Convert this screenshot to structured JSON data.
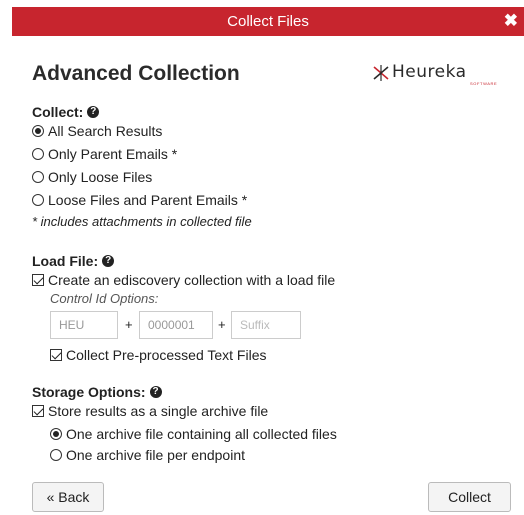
{
  "dialog": {
    "title": "Collect Files",
    "close_label": "✖"
  },
  "heading": "Advanced Collection",
  "logo": {
    "brand": "Heureka",
    "tagline": "SOFTWARE"
  },
  "collect": {
    "label": "Collect:",
    "help": "?",
    "options": [
      {
        "label": "All Search Results",
        "checked": true
      },
      {
        "label": "Only Parent Emails *",
        "checked": false
      },
      {
        "label": "Only Loose Files",
        "checked": false
      },
      {
        "label": "Loose Files and Parent Emails *",
        "checked": false
      }
    ],
    "note": "* includes attachments in collected file"
  },
  "load_file": {
    "label": "Load File:",
    "help": "?",
    "create_label": "Create an ediscovery collection with a load file",
    "create_checked": true,
    "control_id_label": "Control Id Options:",
    "prefix_value": "HEU",
    "number_value": "0000001",
    "suffix_placeholder": "Suffix",
    "plus": "+",
    "preprocessed_label": "Collect Pre-processed Text Files",
    "preprocessed_checked": true
  },
  "storage": {
    "label": "Storage Options:",
    "help": "?",
    "single_archive_label": "Store results as a single archive file",
    "single_archive_checked": true,
    "options": [
      {
        "label": "One archive file containing all collected files",
        "checked": true
      },
      {
        "label": "One archive file per endpoint",
        "checked": false
      }
    ]
  },
  "buttons": {
    "back": "« Back",
    "collect": "Collect"
  },
  "colors": {
    "brand_red": "#c7252e"
  }
}
